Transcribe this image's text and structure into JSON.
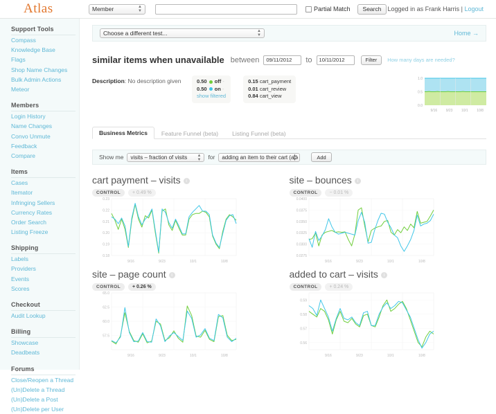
{
  "header": {
    "brand": "Atlas",
    "member_select": "Member",
    "member_options": [
      "Member"
    ],
    "search_value": "",
    "search_placeholder": "",
    "partial_match_label": "Partial Match",
    "partial_match_checked": false,
    "search_button": "Search",
    "logged_in_text": "Logged in as Frank Harris",
    "separator": "|",
    "logout_label": "Logout"
  },
  "sidebar": {
    "groups": [
      {
        "title": "Support Tools",
        "items": [
          "Compass",
          "Knowledge Base",
          "Flags",
          "Shop Name Changes",
          "Bulk Admin Actions",
          "Meteor"
        ]
      },
      {
        "title": "Members",
        "items": [
          "Login History",
          "Name Changes",
          "Convo Unmute",
          "Feedback",
          "Compare"
        ]
      },
      {
        "title": "Items",
        "items": [
          "Cases",
          "Itemator",
          "Infringing Sellers",
          "Currency Rates",
          "Order Search",
          "Listing Freeze"
        ]
      },
      {
        "title": "Shipping",
        "items": [
          "Labels",
          "Providers",
          "Events",
          "Scores"
        ]
      },
      {
        "title": "Checkout",
        "items": [
          "Audit Lookup"
        ]
      },
      {
        "title": "Billing",
        "items": [
          "Showcase",
          "Deadbeats"
        ]
      },
      {
        "title": "Forums",
        "items": [
          "Close/Reopen a Thread",
          "(Un)Delete a Thread",
          "(Un)Delete a Post",
          "(Un)Delete per User"
        ]
      }
    ]
  },
  "chooser": {
    "select_value": "Choose a different test...",
    "home_link": "Home →"
  },
  "test": {
    "title": "similar items when unavailable",
    "between_label": "between",
    "date_from": "09/11/2012",
    "to_label": "to",
    "date_to": "10/11/2012",
    "filter_button": "Filter",
    "help_link": "How many days are needed?"
  },
  "description": {
    "label": "Description",
    "value": "No description given"
  },
  "variant_box": {
    "rows": [
      {
        "value": "0.50",
        "name": "off",
        "color": "#6fce3b",
        "trail": "-"
      },
      {
        "value": "0.50",
        "name": "on",
        "color": "#3fc6e8",
        "trail": "-"
      }
    ],
    "show_filtered": "show filtered"
  },
  "event_box": {
    "rows": [
      {
        "value": "0.15",
        "name": "cart_payment"
      },
      {
        "value": "0.01",
        "name": "cart_review"
      },
      {
        "value": "0.84",
        "name": "cart_view"
      }
    ]
  },
  "tabs": [
    {
      "label": "Business Metrics",
      "active": true
    },
    {
      "label": "Feature Funnel (beta)",
      "active": false
    },
    {
      "label": "Listing Funnel (beta)",
      "active": false
    }
  ],
  "showme": {
    "prefix": "Show me",
    "metric_value": "visits – fraction of visits",
    "for_label": "for",
    "segment_value": "adding an item to their cart (adde",
    "add_button": "Add"
  },
  "colors": {
    "brand": "#e2762c",
    "link": "#5fb8d6",
    "series_control": "#6fce3b",
    "series_variant": "#3fc6e8",
    "area_top": "#aee3f2",
    "area_bottom": "#cfeba2"
  },
  "chart_data": [
    {
      "type": "area",
      "id": "variant-split-sparkline",
      "title": "",
      "stacked": true,
      "ylim": [
        0.0,
        1.0
      ],
      "yticks": [
        "0.0",
        "0.5",
        "1.0"
      ],
      "xticks": [
        "9/16",
        "9/23",
        "10/1",
        "10/8"
      ],
      "series": [
        {
          "name": "off",
          "color": "#cfeba2",
          "values": [
            0.5,
            0.5,
            0.51,
            0.5,
            0.5,
            0.5,
            0.51,
            0.5,
            0.5,
            0.5,
            0.5,
            0.51,
            0.5,
            0.5,
            0.5,
            0.5,
            0.5,
            0.5,
            0.51,
            0.5,
            0.5,
            0.5,
            0.5,
            0.5,
            0.5,
            0.5,
            0.5,
            0.5,
            0.5,
            0.5
          ]
        },
        {
          "name": "on",
          "color": "#aee3f2",
          "values": [
            0.5,
            0.5,
            0.49,
            0.5,
            0.5,
            0.5,
            0.49,
            0.5,
            0.5,
            0.5,
            0.5,
            0.49,
            0.5,
            0.5,
            0.5,
            0.5,
            0.5,
            0.5,
            0.49,
            0.5,
            0.5,
            0.5,
            0.5,
            0.5,
            0.5,
            0.5,
            0.5,
            0.5,
            0.5,
            0.5
          ]
        }
      ]
    },
    {
      "type": "line",
      "id": "cart-payment-visits",
      "title": "cart payment – visits",
      "badge": "CONTROL",
      "delta": "+ 0.49 %",
      "delta_dir": "up",
      "delta_strong": false,
      "ylim": [
        0.18,
        0.23
      ],
      "yticks": [
        "0.23",
        "0.22",
        "0.21",
        "0.20",
        "0.19",
        "0.18"
      ],
      "xticks": [
        "9/16",
        "9/23",
        "10/1",
        "10/8"
      ],
      "series": [
        {
          "name": "control",
          "color": "#6fce3b",
          "values": [
            0.217,
            0.211,
            0.203,
            0.212,
            0.203,
            0.187,
            0.211,
            0.225,
            0.212,
            0.205,
            0.215,
            0.213,
            0.22,
            0.2,
            0.182,
            0.219,
            0.221,
            0.207,
            0.202,
            0.211,
            0.204,
            0.198,
            0.198,
            0.212,
            0.216,
            0.217,
            0.217,
            0.219,
            0.218,
            0.214,
            0.197,
            0.19,
            0.186,
            0.201,
            0.212,
            0.216,
            0.214,
            0.211
          ]
        },
        {
          "name": "variant",
          "color": "#3fc6e8",
          "values": [
            0.214,
            0.212,
            0.208,
            0.213,
            0.206,
            0.188,
            0.213,
            0.226,
            0.214,
            0.207,
            0.212,
            0.215,
            0.221,
            0.202,
            0.183,
            0.221,
            0.218,
            0.209,
            0.204,
            0.212,
            0.206,
            0.199,
            0.199,
            0.214,
            0.218,
            0.221,
            0.224,
            0.219,
            0.219,
            0.216,
            0.198,
            0.191,
            0.187,
            0.199,
            0.211,
            0.215,
            0.216,
            0.208
          ]
        }
      ]
    },
    {
      "type": "line",
      "id": "site-bounces",
      "title": "site – bounces",
      "badge": "CONTROL",
      "delta": "− 0.01 %",
      "delta_dir": "down",
      "delta_strong": false,
      "ylim": [
        0.0275,
        0.04
      ],
      "yticks": [
        "0.0400",
        "0.0375",
        "0.0350",
        "0.0325",
        "0.0300",
        "0.0275"
      ],
      "xticks": [
        "9/16",
        "9/23",
        "10/1",
        "10/8"
      ],
      "series": [
        {
          "name": "control",
          "color": "#6fce3b",
          "values": [
            0.031,
            0.0312,
            0.0325,
            0.0296,
            0.032,
            0.0326,
            0.0328,
            0.033,
            0.0326,
            0.0327,
            0.0326,
            0.0327,
            0.031,
            0.0296,
            0.0322,
            0.0375,
            0.038,
            0.034,
            0.0305,
            0.033,
            0.0335,
            0.0338,
            0.034,
            0.035,
            0.0352,
            0.0326,
            0.032,
            0.0332,
            0.0325,
            0.0338,
            0.033,
            0.0344,
            0.0336,
            0.0372,
            0.0346,
            0.0348,
            0.035,
            0.0362,
            0.0375
          ]
        },
        {
          "name": "variant",
          "color": "#3fc6e8",
          "values": [
            0.0312,
            0.0293,
            0.0328,
            0.0308,
            0.0318,
            0.0332,
            0.0356,
            0.0338,
            0.0326,
            0.0322,
            0.0324,
            0.0326,
            0.0324,
            0.0322,
            0.032,
            0.0352,
            0.037,
            0.0348,
            0.0302,
            0.0304,
            0.033,
            0.0352,
            0.0368,
            0.0366,
            0.0348,
            0.0336,
            0.032,
            0.0314,
            0.0296,
            0.0284,
            0.0296,
            0.031,
            0.033,
            0.0364,
            0.034,
            0.0344,
            0.0346,
            0.0352,
            0.0366
          ]
        }
      ]
    },
    {
      "type": "line",
      "id": "site-page-count",
      "title": "site – page count",
      "badge": "CONTROL",
      "delta": "+ 0.26 %",
      "delta_dir": "up",
      "delta_strong": true,
      "ylim": [
        55.0,
        65.0
      ],
      "yticks": [
        "65.0",
        "62.5",
        "60.0",
        "57.5"
      ],
      "xticks": [
        "9/16",
        "9/23",
        "10/1",
        "10/8"
      ],
      "series": [
        {
          "name": "control",
          "color": "#6fce3b",
          "values": [
            56.5,
            56.0,
            57.4,
            61.5,
            58.2,
            56.6,
            56.3,
            57.8,
            56.2,
            56.5,
            60.0,
            59.5,
            56.6,
            57.1,
            58.3,
            57.0,
            56.3,
            62.7,
            61.0,
            57.4,
            57.2,
            58.4,
            56.8,
            56.4,
            60.8,
            61.0,
            57.5,
            56.6,
            56.8
          ]
        },
        {
          "name": "variant",
          "color": "#3fc6e8",
          "values": [
            56.6,
            56.2,
            57.2,
            62.4,
            58.0,
            56.4,
            56.5,
            58.0,
            56.4,
            56.3,
            60.4,
            59.2,
            56.4,
            57.4,
            58.0,
            57.3,
            56.6,
            61.8,
            60.5,
            57.2,
            57.6,
            58.7,
            57.0,
            56.6,
            61.2,
            60.6,
            57.2,
            56.4,
            57.0
          ]
        }
      ]
    },
    {
      "type": "line",
      "id": "added-to-cart-visits",
      "title": "added to cart – visits",
      "badge": "CONTROL",
      "delta": "+ 0.24 %",
      "delta_dir": "up",
      "delta_strong": false,
      "ylim": [
        0.555,
        0.595
      ],
      "yticks": [
        "0.59",
        "0.58",
        "0.57",
        "0.56"
      ],
      "xticks": [
        "9/16",
        "9/23",
        "10/1",
        "10/8"
      ],
      "series": [
        {
          "name": "control",
          "color": "#6fce3b",
          "values": [
            0.582,
            0.58,
            0.578,
            0.584,
            0.582,
            0.576,
            0.566,
            0.576,
            0.582,
            0.575,
            0.574,
            0.577,
            0.573,
            0.571,
            0.579,
            0.58,
            0.572,
            0.571,
            0.578,
            0.586,
            0.59,
            0.582,
            0.584,
            0.587,
            0.589,
            0.584,
            0.576,
            0.568,
            0.56,
            0.557,
            0.564,
            0.568,
            0.566
          ]
        },
        {
          "name": "variant",
          "color": "#3fc6e8",
          "values": [
            0.586,
            0.584,
            0.579,
            0.59,
            0.584,
            0.578,
            0.568,
            0.577,
            0.584,
            0.577,
            0.576,
            0.578,
            0.574,
            0.572,
            0.581,
            0.582,
            0.572,
            0.572,
            0.58,
            0.585,
            0.588,
            0.584,
            0.586,
            0.589,
            0.588,
            0.583,
            0.578,
            0.57,
            0.562,
            0.556,
            0.56,
            0.566,
            0.568
          ]
        }
      ]
    }
  ]
}
